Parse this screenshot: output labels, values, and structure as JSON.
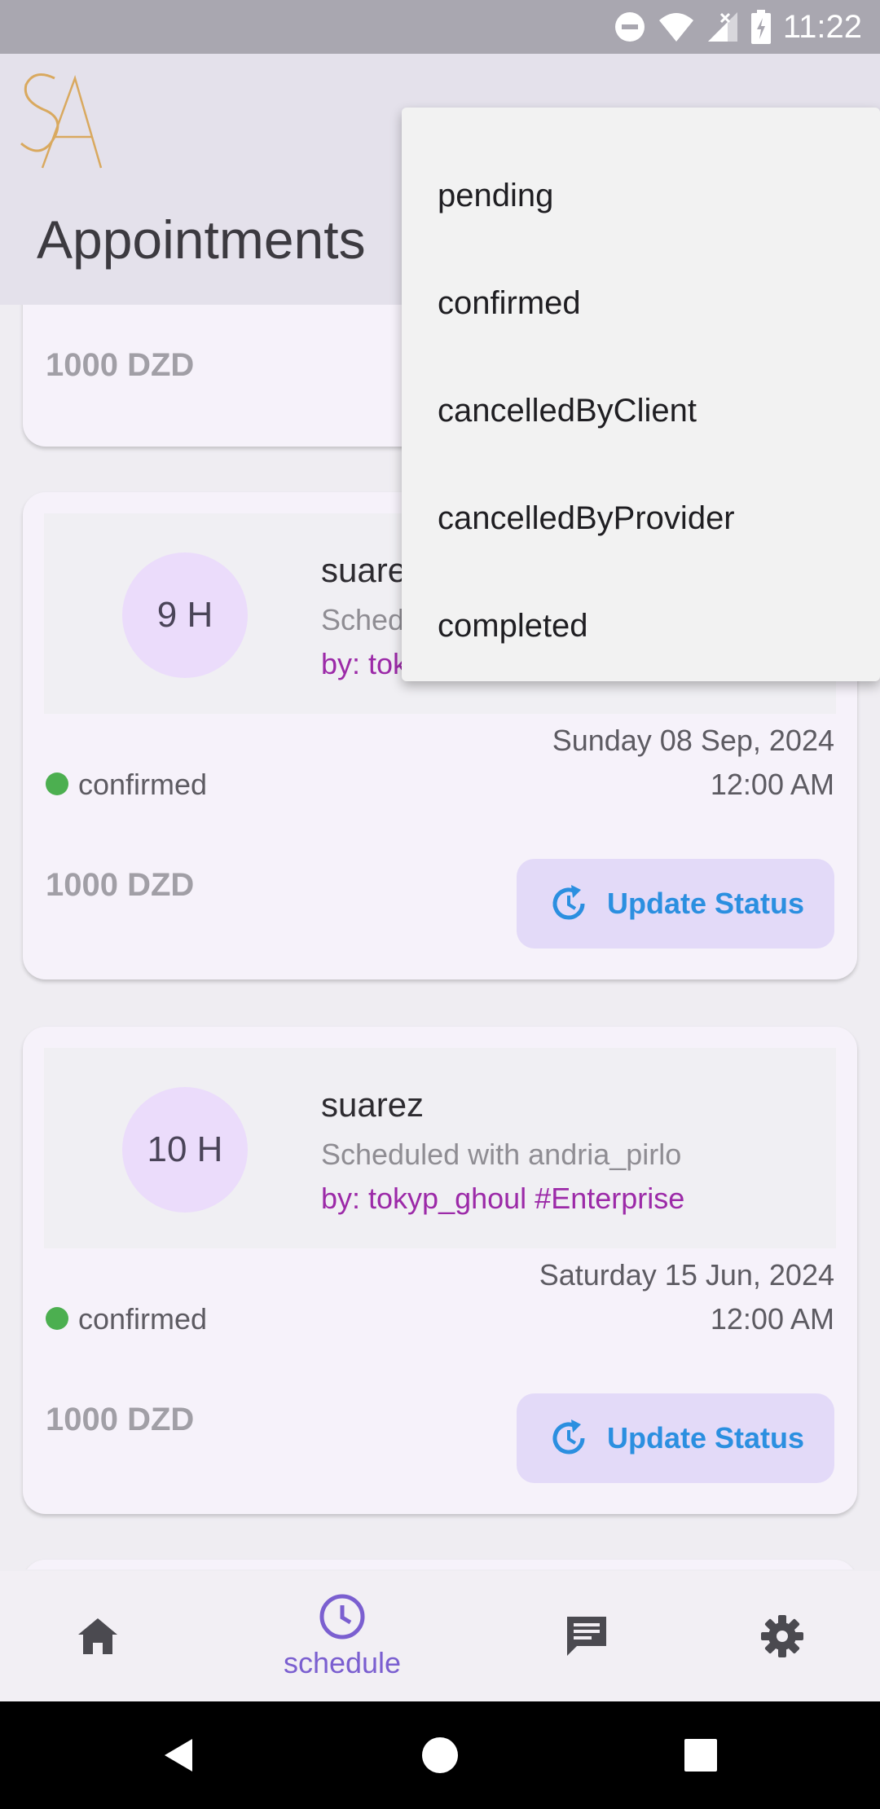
{
  "status_bar": {
    "time": "11:22"
  },
  "app_bar": {
    "logo_text": "SA",
    "title": "Appointments"
  },
  "cards": [
    {
      "price": "1000 DZD"
    },
    {
      "avatar": "9 H",
      "client": "suarez",
      "scheduled_with": "Scheduled with andria_pirlo",
      "by": "by: tokyp_ghoul #Enterprise",
      "status": "confirmed",
      "date": "Sunday 08 Sep, 2024",
      "time": "12:00 AM",
      "price": "1000 DZD",
      "button": "Update Status"
    },
    {
      "avatar": "10 H",
      "client": "suarez",
      "scheduled_with": "Scheduled with andria_pirlo",
      "by": "by: tokyp_ghoul #Enterprise",
      "status": "confirmed",
      "date": "Saturday 15 Jun, 2024",
      "time": "12:00 AM",
      "price": "1000 DZD",
      "button": "Update Status"
    }
  ],
  "status_menu": {
    "items": [
      "pending",
      "confirmed",
      "cancelledByClient",
      "cancelledByProvider",
      "completed"
    ]
  },
  "bottom_nav": {
    "items": [
      {
        "icon": "home-icon",
        "label": ""
      },
      {
        "icon": "clock-icon",
        "label": "schedule",
        "active": true
      },
      {
        "icon": "chat-icon",
        "label": ""
      },
      {
        "icon": "gear-icon",
        "label": ""
      }
    ]
  },
  "colors": {
    "accent": "#7b5fd0",
    "status_confirmed": "#4caf50",
    "button_text": "#2b8fe0",
    "by_line": "#9c2aa8"
  }
}
